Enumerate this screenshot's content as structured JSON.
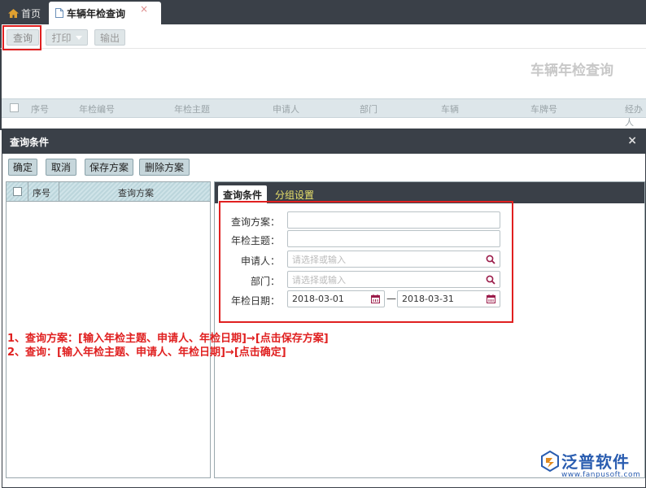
{
  "tabs": {
    "home_label": "首页",
    "active_label": "车辆年检查询",
    "close_glyph": "×"
  },
  "toolbar": {
    "query_label": "查询",
    "print_label": "打印",
    "export_label": "输出"
  },
  "page": {
    "title": "车辆年检查询",
    "columns": [
      "序号",
      "年检编号",
      "年检主题",
      "申请人",
      "部门",
      "车辆",
      "车牌号",
      "经办人"
    ]
  },
  "dialog": {
    "title": "查询条件",
    "close_glyph": "×",
    "buttons": {
      "confirm": "确定",
      "cancel": "取消",
      "save_scheme": "保存方案",
      "delete_scheme": "删除方案"
    },
    "scheme_table": {
      "col_index": "序号",
      "col_scheme": "查询方案"
    },
    "tabs": {
      "conditions": "查询条件",
      "grouping": "分组设置"
    },
    "form": {
      "scheme_label": "查询方案：",
      "scheme_value": "",
      "subject_label": "年检主题：",
      "subject_value": "",
      "applicant_label": "申请人：",
      "applicant_placeholder": "请选择或输入",
      "dept_label": "部门：",
      "dept_placeholder": "请选择或输入",
      "date_label": "年检日期：",
      "date_from": "2018-03-01",
      "date_sep": "—",
      "date_to": "2018-03-31"
    }
  },
  "annotations": {
    "note1": "1、查询方案：[输入年检主题、申请人、年检日期]→[点击保存方案]",
    "note2": "2、查询：[输入年检主题、申请人、年检日期]→[点击确定]"
  },
  "logo": {
    "name": "泛普软件",
    "url": "www.fanpusoft.com"
  },
  "colors": {
    "dark_bar": "#3a4048",
    "highlight_red": "#e02020",
    "logo_blue": "#2a5db0",
    "tab_yellow": "#e8e06a"
  }
}
